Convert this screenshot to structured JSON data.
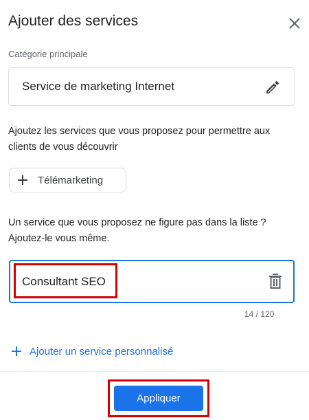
{
  "dialog": {
    "title": "Ajouter des services",
    "close_icon": "close-icon"
  },
  "primary_category": {
    "label": "Catégorie principale",
    "value": "Service de marketing Internet",
    "edit_icon": "pencil-icon"
  },
  "suggestions": {
    "helper_text": "Ajoutez les services que vous proposez pour permettre aux clients de vous découvrir",
    "chips": [
      {
        "label": "Télémarketing",
        "icon": "plus-icon"
      }
    ]
  },
  "custom_service": {
    "helper_text": "Un service que vous proposez ne figure pas dans la liste ? Ajoutez-le vous même.",
    "value": "Consultant SEO",
    "counter": "14 / 120",
    "delete_icon": "trash-icon",
    "add_link_label": "Ajouter un service personnalisé"
  },
  "footer": {
    "apply_label": "Appliquer"
  },
  "colors": {
    "accent": "#1a73e8",
    "highlight": "#d50000",
    "border": "#dadce0",
    "text": "#202124",
    "muted": "#5f6368"
  }
}
